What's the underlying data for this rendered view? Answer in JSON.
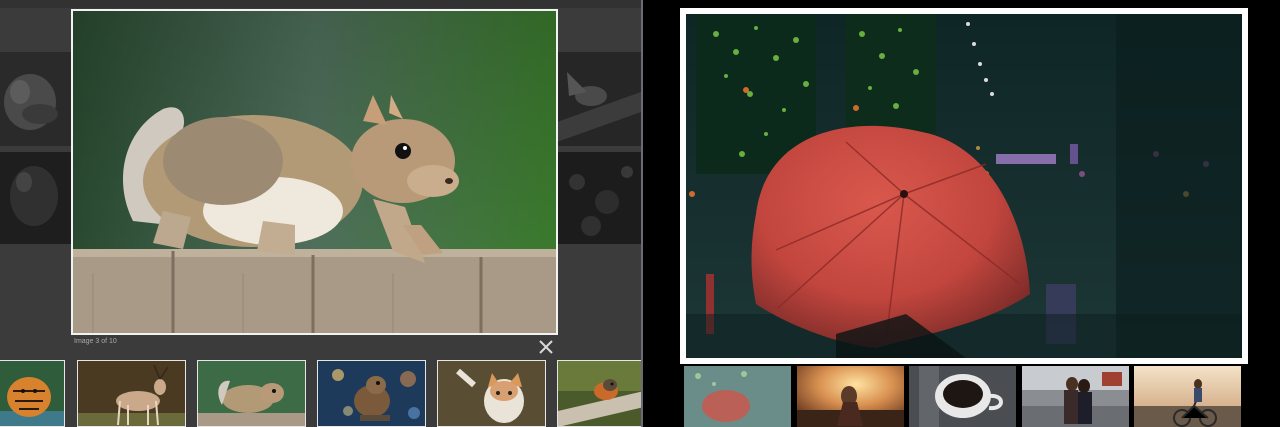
{
  "lightbox": {
    "caption": "Image 3 of 10",
    "main_image": "squirrel-on-fence",
    "close_icon": "close-icon",
    "colors": {
      "background": "#3b3b3b",
      "frame_border": "#f2f2f2",
      "caption_text": "#a9a9a9"
    },
    "side_previews": [
      "fox-dark",
      "animal-dark",
      "bird-dark",
      "bark-dark"
    ],
    "thumbnails": [
      "tiger",
      "deer",
      "squirrel",
      "bird-lights",
      "cat",
      "robin"
    ]
  },
  "gallery": {
    "main_image": "red-umbrella-night",
    "colors": {
      "background": "#000000",
      "frame_border": "#ffffff",
      "umbrella": "#c8483f"
    },
    "thumbnails": [
      "umbrella-faded",
      "sunset-portrait",
      "coffee-cup",
      "couple-street",
      "bike-road"
    ]
  }
}
